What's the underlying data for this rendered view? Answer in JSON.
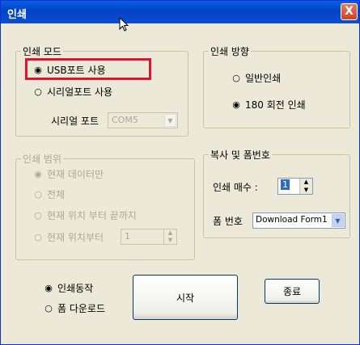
{
  "window": {
    "title": "인쇄",
    "close_label": "X"
  },
  "print_mode": {
    "legend": "인쇄 모드",
    "usb_label": "USB포트 사용",
    "usb_selected": true,
    "serial_label": "시리얼포트 사용",
    "serial_port_label": "시리얼 포트",
    "serial_port_value": "COM5"
  },
  "print_direction": {
    "legend": "인쇄 방향",
    "normal_label": "일반인쇄",
    "rotate_label": "180 회전 인쇄",
    "rotate_selected": true
  },
  "print_range": {
    "legend": "인쇄 범위",
    "current_data_label": "현재 데이터만",
    "all_label": "전체",
    "to_end_label": "현재 위치 부터 끝까지",
    "from_current_label": "현재 위치부터",
    "from_current_value": "1"
  },
  "copies_form": {
    "legend": "복사 및 폼번호",
    "copies_label": "인쇄 매수 :",
    "copies_value": "1",
    "form_label": "폼 번호",
    "form_value": "Download Form1"
  },
  "action": {
    "print_label": "인쇄동작",
    "print_selected": true,
    "download_label": "폼 다운로드"
  },
  "buttons": {
    "start": "시작",
    "close": "종료"
  }
}
